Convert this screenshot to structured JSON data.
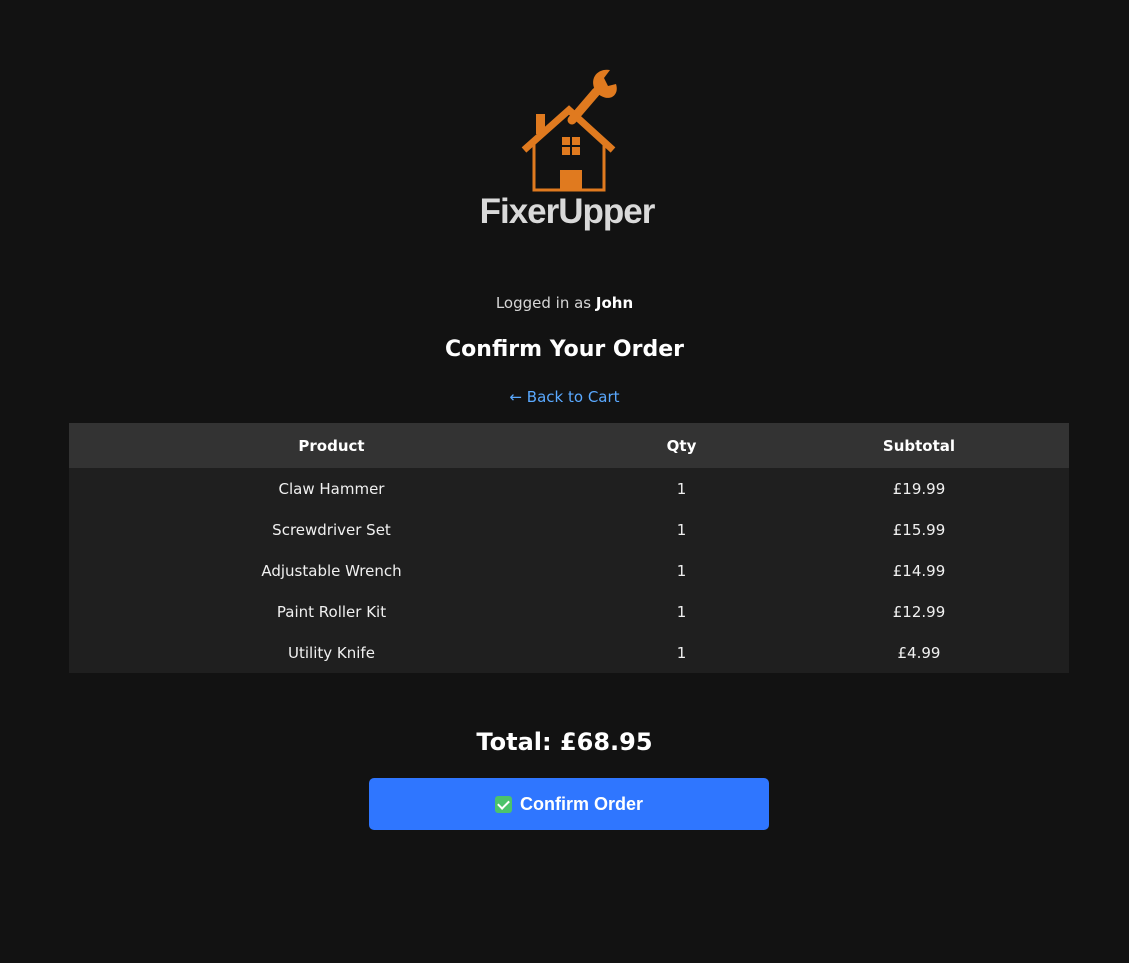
{
  "brand": {
    "name": "FixerUpper",
    "accent_color": "#e07a1f",
    "logo_icon": "house-wrench-icon"
  },
  "user": {
    "prefix": "Logged in as ",
    "name": "John"
  },
  "page": {
    "title": "Confirm Your Order",
    "back_link": "← Back to Cart"
  },
  "order_table": {
    "headers": [
      "Product",
      "Qty",
      "Subtotal"
    ],
    "rows": [
      {
        "product": "Claw Hammer",
        "qty": "1",
        "subtotal": "£19.99"
      },
      {
        "product": "Screwdriver Set",
        "qty": "1",
        "subtotal": "£15.99"
      },
      {
        "product": "Adjustable Wrench",
        "qty": "1",
        "subtotal": "£14.99"
      },
      {
        "product": "Paint Roller Kit",
        "qty": "1",
        "subtotal": "£12.99"
      },
      {
        "product": "Utility Knife",
        "qty": "1",
        "subtotal": "£4.99"
      }
    ]
  },
  "total": {
    "label": "Total: £68.95"
  },
  "confirm": {
    "label": "Confirm Order",
    "icon": "check-mark-icon",
    "color": "#2f76ff"
  }
}
